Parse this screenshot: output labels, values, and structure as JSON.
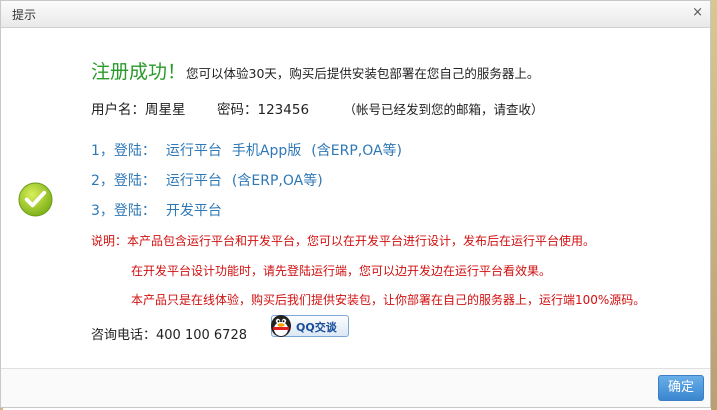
{
  "dialog": {
    "title": "提示",
    "close_glyph": "×",
    "ok_label": "确定"
  },
  "headline": {
    "success": "注册成功！",
    "message": "您可以体验30天，购买后提供安装包部署在您自己的服务器上。"
  },
  "account": {
    "user_label": "用户名：",
    "user_value": "周星星",
    "password_label": "密码：",
    "password_value": "123456",
    "note": "（帐号已经发到您的邮箱，请查收）"
  },
  "entries": [
    {
      "prefix": "1，登陆：",
      "links": [
        "运行平台",
        "手机App版",
        "(含ERP,OA等)"
      ]
    },
    {
      "prefix": "2，登陆：",
      "links": [
        "运行平台",
        "(含ERP,OA等)"
      ]
    },
    {
      "prefix": "3，登陆：",
      "links": [
        "开发平台"
      ]
    }
  ],
  "notes": {
    "line1": "说明：本产品包含运行平台和开发平台，您可以在开发平台进行设计，发布后在运行平台使用。",
    "line2": "在开发平台设计功能时，请先登陆运行端，您可以边开发边在运行平台看效果。",
    "line3": "本产品只是在线体验，购买后我们提供安装包，让你部署在自己的服务器上，运行端100%源码。"
  },
  "contact": {
    "phone_label": "咨询电话：",
    "phone_value": "400 100 6728",
    "qq_label": "QQ交谈"
  },
  "colors": {
    "success_green": "#2a9a2a",
    "link_blue": "#2f78b6",
    "note_red": "#d01010",
    "button_blue": "#3a86d0"
  }
}
